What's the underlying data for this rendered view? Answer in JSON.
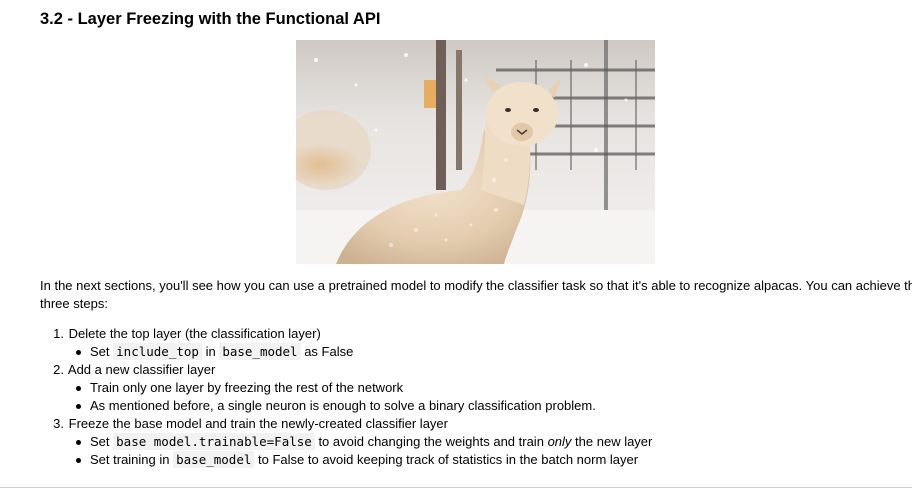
{
  "section": {
    "heading": "3.2 - Layer Freezing with the Functional API"
  },
  "figure": {
    "subject": "alpaca-in-snow photo"
  },
  "intro": {
    "text": "In the next sections, you'll see how you can use a pretrained model to modify the classifier task so that it's able to recognize alpacas. You can achieve this in",
    "text_cont": "three steps:"
  },
  "steps": [
    {
      "num": "1.",
      "label": "Delete the top layer (the classification layer)",
      "sub": [
        {
          "pre": "Set",
          "code1": "include_top",
          "mid": "in",
          "code2": "base_model",
          "post": "as False"
        }
      ]
    },
    {
      "num": "2.",
      "label": "Add a new classifier layer",
      "sub": [
        {
          "text": "Train only one layer by freezing the rest of the network"
        },
        {
          "text": "As mentioned before, a single neuron is enough to solve a binary classification problem."
        }
      ]
    },
    {
      "num": "3.",
      "label": "Freeze the base model and train the newly-created classifier layer",
      "sub": [
        {
          "pre": "Set",
          "code": "base model.trainable=False",
          "mid": "to avoid changing the weights and train",
          "em": "only",
          "post": "the new layer"
        },
        {
          "pre": "Set training in",
          "code": "base_model",
          "post": "to False to avoid keeping track of statistics in the batch norm layer"
        }
      ]
    }
  ]
}
